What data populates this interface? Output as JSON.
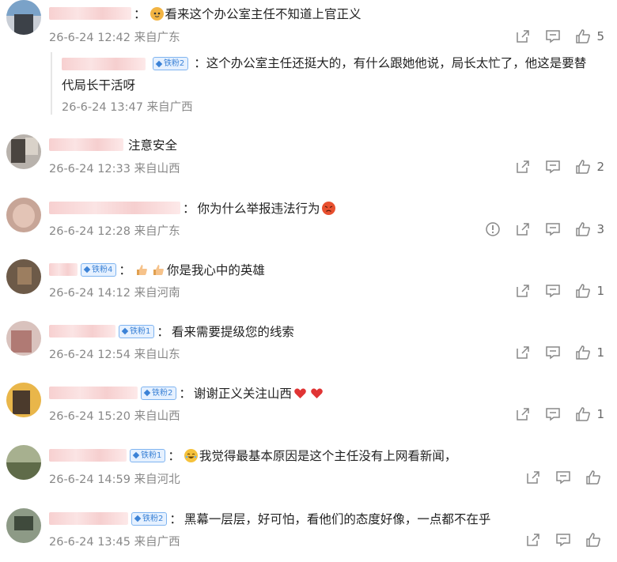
{
  "comments": [
    {
      "text": "看来这个办公室主任不知道上官正义",
      "time": "26-6-24 12:42",
      "location": "来自广东",
      "likes": "5",
      "reply": {
        "badge": "铁粉2",
        "text": "这个办公室主任还挺大的，有什么跟她他说，局长太忙了，他这是要替",
        "text2": "代局长干活呀",
        "time": "26-6-24 13:47",
        "location": "来自广西"
      }
    },
    {
      "text": "注意安全",
      "time": "26-6-24 12:33",
      "location": "来自山西",
      "likes": "2"
    },
    {
      "text": "你为什么举报违法行为",
      "time": "26-6-24 12:28",
      "location": "来自广东",
      "likes": "3"
    },
    {
      "badge": "铁粉4",
      "text": "你是我心中的英雄",
      "time": "26-6-24 14:12",
      "location": "来自河南",
      "likes": "1"
    },
    {
      "badge": "铁粉1",
      "text": "看来需要提级您的线索",
      "time": "26-6-24 12:54",
      "location": "来自山东",
      "likes": "1"
    },
    {
      "badge": "铁粉2",
      "text": "谢谢正义关注山西",
      "time": "26-6-24 15:20",
      "location": "来自山西",
      "likes": "1"
    },
    {
      "badge": "铁粉1",
      "text": "我觉得最基本原因是这个主任没有上网看新闻，",
      "time": "26-6-24 14:59",
      "location": "来自河北",
      "likes": ""
    },
    {
      "badge": "铁粉2",
      "text": "黑幕一层层，好可怕，看他们的态度好像，一点都不在乎",
      "time": "26-6-24 13:45",
      "location": "来自广西",
      "likes": ""
    }
  ],
  "colon": "：",
  "icons": {
    "share": "share-icon",
    "comment": "comment-icon",
    "like": "thumbs-up-icon",
    "report": "report-icon"
  }
}
